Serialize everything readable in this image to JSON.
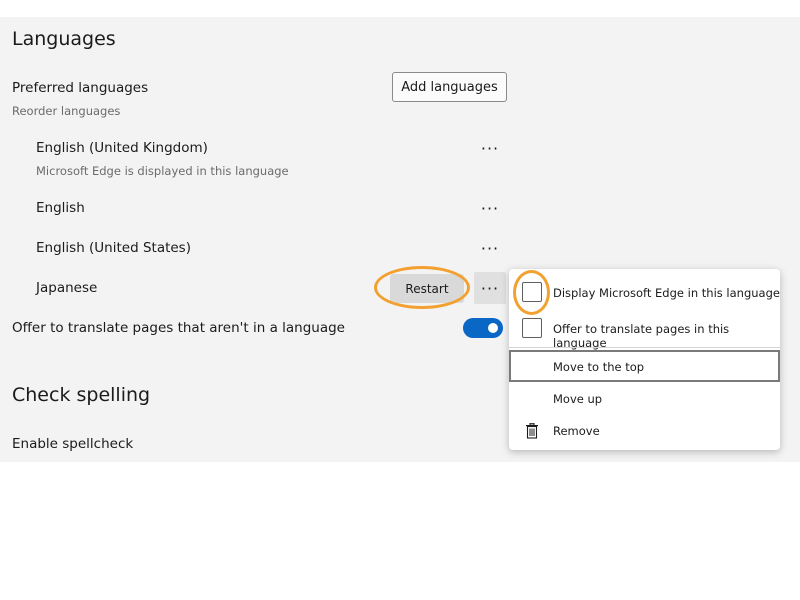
{
  "languages": {
    "heading": "Languages",
    "preferred_label": "Preferred languages",
    "reorder_label": "Reorder languages",
    "add_button": "Add languages",
    "items": [
      {
        "name": "English (United Kingdom)",
        "note": "Microsoft Edge is displayed in this language"
      },
      {
        "name": "English",
        "note": ""
      },
      {
        "name": "English (United States)",
        "note": ""
      },
      {
        "name": "Japanese",
        "note": ""
      }
    ],
    "more_glyph": "···",
    "restart_button": "Restart",
    "offer_translate": {
      "label": "Offer to translate pages that aren't in a language you",
      "toggle_on": true
    }
  },
  "spelling": {
    "heading": "Check spelling",
    "enable_label": "Enable spellcheck"
  },
  "context_menu": {
    "display_in_language": "Display Microsoft Edge in this language",
    "offer_translate": "Offer to translate pages in this language",
    "move_top": "Move to the top",
    "move_up": "Move up",
    "remove": "Remove"
  },
  "colors": {
    "toggle_on": "#0a67c5",
    "highlight_ring": "#f2a130",
    "panel_bg": "#f3f3f3"
  },
  "icons": {
    "more": "more-options-icon",
    "remove": "trash-icon"
  }
}
